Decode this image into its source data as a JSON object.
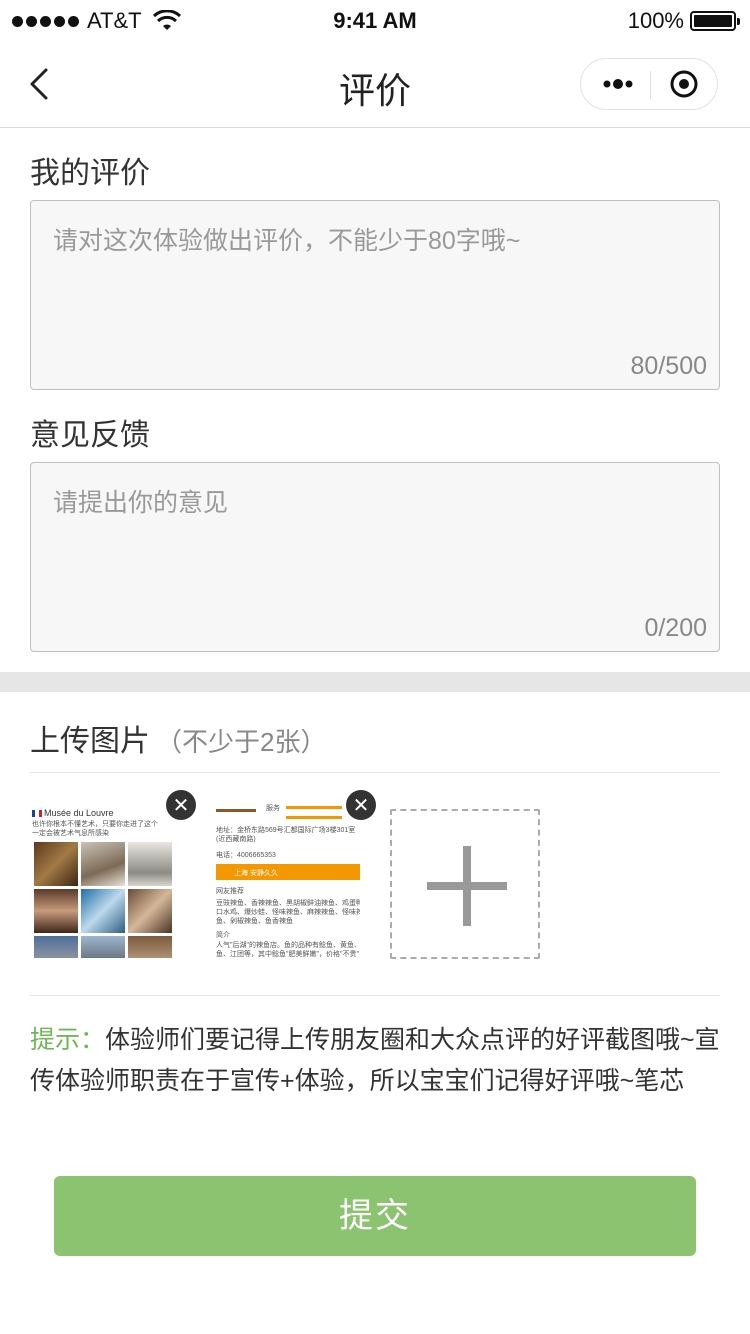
{
  "status_bar": {
    "carrier": "AT&T",
    "time": "9:41 AM",
    "battery": "100%"
  },
  "nav": {
    "title": "评价"
  },
  "review": {
    "label": "我的评价",
    "placeholder": "请对这次体验做出评价，不能少于80字哦~",
    "counter": "80/500"
  },
  "feedback": {
    "label": "意见反馈",
    "placeholder": "请提出你的意见",
    "counter": "0/200"
  },
  "upload": {
    "title": "上传图片",
    "hint": "（不少于2张）",
    "thumb1": {
      "header": "Musée du Louvre",
      "caption1": "也许你根本不懂艺术，只要你走进了这个",
      "caption2": "一定会被艺术气息所感染"
    },
    "thumb2": {
      "row1": "服务",
      "address": "地址：金桥东路569号汇都国际广场3楼301室(近西藏南路)",
      "phone": "电话：4006665353",
      "banner": "上海 安静久久",
      "section1": "网友推荐",
      "items1": "豆豉辣鱼、香辣辣鱼、黑胡椒鲜油辣鱼、鸡蛋鸭肉、",
      "items2": "口水鸡、爆炒蛙、怪味辣鱼、麻辣辣鱼、怪味辣鱼王",
      "items3": "鱼、剁椒辣鱼、鱼香辣鱼",
      "section2": "简介",
      "intro1": "人气\"后湖\"的辣鱼店。鱼的品种有鲶鱼、黄鱼、清江",
      "intro2": "鱼、江团等，其中鲶鱼\"肥美鲜嫩\"，价格\"不贵\"，点的"
    },
    "colors": {
      "banner": "#f39800"
    }
  },
  "tip": {
    "label": "提示：",
    "text": "体验师们要记得上传朋友圈和大众点评的好评截图哦~宣传体验师职责在于宣传+体验，所以宝宝们记得好评哦~笔芯"
  },
  "submit": {
    "label": "提交"
  },
  "colors": {
    "accent_green": "#8bc370",
    "tip_green": "#6fb855"
  }
}
